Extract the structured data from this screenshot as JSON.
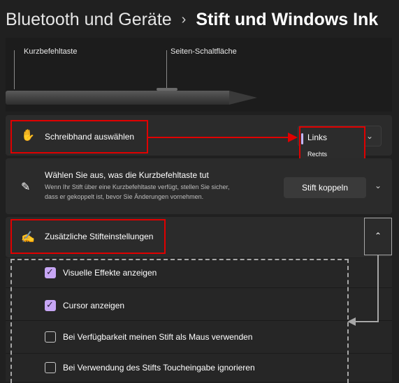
{
  "breadcrumb": {
    "parent": "Bluetooth und Geräte",
    "separator": "›",
    "current": "Stift und Windows Ink"
  },
  "pen_illustration": {
    "shortcut_label": "Kurzbefehltaste",
    "side_button_label": "Seiten-Schaltfläche"
  },
  "handedness": {
    "icon": "hand-icon",
    "label": "Schreibhand auswählen",
    "options": [
      "Links",
      "Rechts"
    ],
    "selected": "Links"
  },
  "shortcut": {
    "icon": "pen-icon",
    "title": "Wählen Sie aus, was die Kurzbefehltaste tut",
    "description_line1": "Wenn Ihr Stift über eine Kurzbefehltaste verfügt, stellen Sie sicher,",
    "description_line2": "dass er gekoppelt ist, bevor Sie Änderungen vornehmen.",
    "button_label": "Stift koppeln"
  },
  "additional": {
    "icon": "pen-settings-icon",
    "label": "Zusätzliche Stifteinstellungen",
    "expanded": true
  },
  "options": [
    {
      "label": "Visuelle Effekte anzeigen",
      "checked": true
    },
    {
      "label": "Cursor anzeigen",
      "checked": true
    },
    {
      "label": "Bei Verfügbarkeit meinen Stift als Maus verwenden",
      "checked": false
    },
    {
      "label": "Bei Verwendung des Stifts Toucheingabe ignorieren",
      "checked": false
    }
  ],
  "colors": {
    "highlight": "#e00000",
    "accent": "#c7a6f5",
    "background": "#202020",
    "card": "#2b2b2b"
  }
}
